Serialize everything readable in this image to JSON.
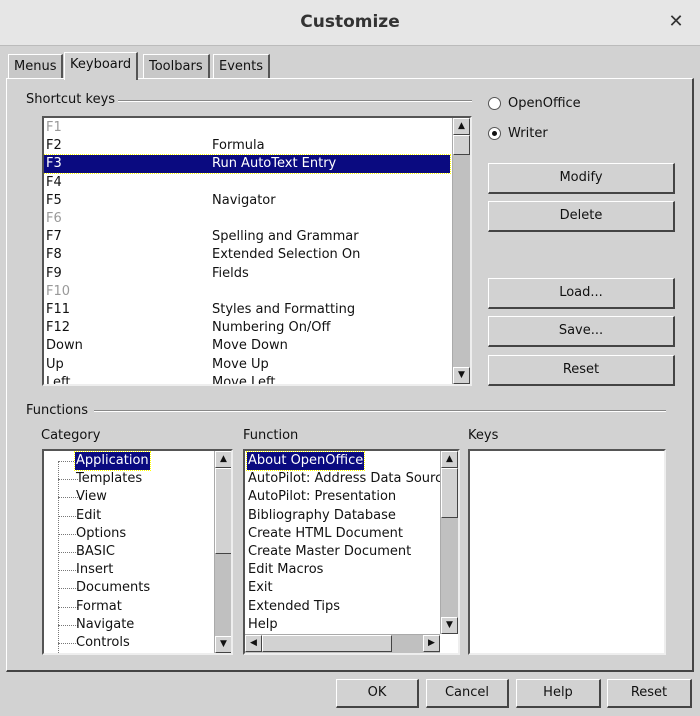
{
  "window": {
    "title": "Customize"
  },
  "tabs": [
    {
      "label": "Menus"
    },
    {
      "label": "Keyboard",
      "active": true
    },
    {
      "label": "Toolbars"
    },
    {
      "label": "Events"
    }
  ],
  "shortcut_keys": {
    "label": "Shortcut keys",
    "rows": [
      {
        "key": "F1",
        "function": "",
        "disabled": true
      },
      {
        "key": "F2",
        "function": "Formula"
      },
      {
        "key": "F3",
        "function": "Run AutoText Entry",
        "selected": true
      },
      {
        "key": "F4",
        "function": ""
      },
      {
        "key": "F5",
        "function": "Navigator"
      },
      {
        "key": "F6",
        "function": "",
        "disabled": true
      },
      {
        "key": "F7",
        "function": "Spelling and Grammar"
      },
      {
        "key": "F8",
        "function": "Extended Selection On"
      },
      {
        "key": "F9",
        "function": "Fields"
      },
      {
        "key": "F10",
        "function": "",
        "disabled": true
      },
      {
        "key": "F11",
        "function": "Styles and Formatting"
      },
      {
        "key": "F12",
        "function": "Numbering On/Off"
      },
      {
        "key": "Down",
        "function": "Move Down"
      },
      {
        "key": "Up",
        "function": "Move Up"
      },
      {
        "key": "Left",
        "function": "Move Left"
      }
    ]
  },
  "scope": {
    "options": [
      {
        "label": "OpenOffice",
        "checked": false
      },
      {
        "label": "Writer",
        "checked": true
      }
    ]
  },
  "side_buttons": {
    "modify": "Modify",
    "delete": "Delete",
    "load": "Load...",
    "save": "Save...",
    "reset": "Reset"
  },
  "functions": {
    "label": "Functions",
    "category_label": "Category",
    "function_label": "Function",
    "keys_label": "Keys",
    "categories": [
      "Application",
      "Templates",
      "View",
      "Edit",
      "Options",
      "BASIC",
      "Insert",
      "Documents",
      "Format",
      "Navigate",
      "Controls"
    ],
    "function_items": [
      "About OpenOffice",
      "AutoPilot: Address Data Source",
      "AutoPilot: Presentation",
      "Bibliography Database",
      "Create HTML Document",
      "Create Master Document",
      "Edit Macros",
      "Exit",
      "Extended Tips",
      "Help"
    ]
  },
  "footer": {
    "ok": "OK",
    "cancel": "Cancel",
    "help": "Help",
    "reset": "Reset"
  }
}
